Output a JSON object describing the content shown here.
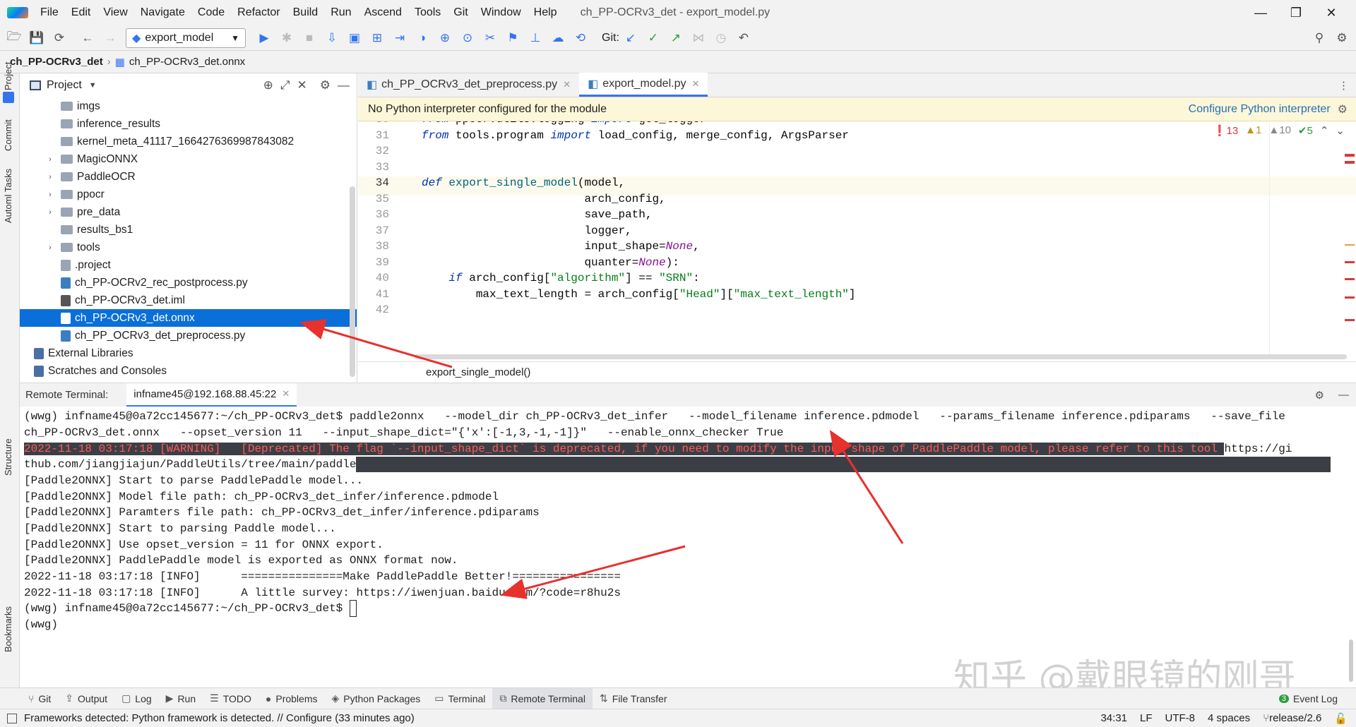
{
  "app": {
    "project": "ch_PP-OCRv3_det",
    "window_title": "ch_PP-OCRv3_det - export_model.py"
  },
  "menu": [
    "File",
    "Edit",
    "View",
    "Navigate",
    "Code",
    "Refactor",
    "Build",
    "Run",
    "Ascend",
    "Tools",
    "Git",
    "Window",
    "Help"
  ],
  "toolbar": {
    "run_config": "export_model",
    "git_label": "Git:"
  },
  "breadcrumb": {
    "project": "ch_PP-OCRv3_det",
    "file": "ch_PP-OCRv3_det.onnx"
  },
  "left_strip": {
    "project": "Project",
    "commit": "Commit",
    "automl": "Automl Tasks",
    "structure": "Structure",
    "bookmarks": "Bookmarks"
  },
  "project_panel": {
    "title": "Project",
    "items": [
      {
        "label": "imgs",
        "type": "folder",
        "arrow": ""
      },
      {
        "label": "inference_results",
        "type": "folder",
        "arrow": ""
      },
      {
        "label": "kernel_meta_41117_1664276369987843082",
        "type": "folder",
        "arrow": ""
      },
      {
        "label": "MagicONNX",
        "type": "folder",
        "arrow": "›"
      },
      {
        "label": "PaddleOCR",
        "type": "folder",
        "arrow": "›"
      },
      {
        "label": "ppocr",
        "type": "folder",
        "arrow": "›"
      },
      {
        "label": "pre_data",
        "type": "folder",
        "arrow": "›"
      },
      {
        "label": "results_bs1",
        "type": "folder",
        "arrow": ""
      },
      {
        "label": "tools",
        "type": "folder",
        "arrow": "›"
      },
      {
        "label": ".project",
        "type": "file",
        "arrow": ""
      },
      {
        "label": "ch_PP-OCRv2_rec_postprocess.py",
        "type": "py",
        "arrow": ""
      },
      {
        "label": "ch_PP-OCRv3_det.iml",
        "type": "iml",
        "arrow": ""
      },
      {
        "label": "ch_PP-OCRv3_det.onnx",
        "type": "onnx",
        "arrow": "",
        "selected": true
      },
      {
        "label": "ch_PP_OCRv3_det_preprocess.py",
        "type": "py",
        "arrow": ""
      },
      {
        "label": "External Libraries",
        "type": "lib",
        "arrow": ""
      },
      {
        "label": "Scratches and Consoles",
        "type": "scratch",
        "arrow": ""
      }
    ]
  },
  "editor": {
    "tabs": [
      {
        "label": "ch_PP_OCRv3_det_preprocess.py",
        "active": false
      },
      {
        "label": "export_model.py",
        "active": true
      }
    ],
    "banner": "No Python interpreter configured for the module",
    "banner_action": "Configure Python interpreter",
    "inspections": {
      "errors": "13",
      "warnings": "1",
      "weak": "10",
      "ok": "5"
    },
    "lines": [
      {
        "n": "30",
        "html": "<span class=\"kw\">from</span> ppocr.utils.logging <span class=\"kw\">import</span> get_logger"
      },
      {
        "n": "31",
        "html": "<span class=\"kw\">from</span> tools.program <span class=\"kw\">import</span> load_config, merge_config, ArgsParser"
      },
      {
        "n": "32",
        "html": ""
      },
      {
        "n": "33",
        "html": ""
      },
      {
        "n": "34",
        "html": "<span class=\"kw\">def</span> <span class=\"fn\">export_single_model</span>(model,"
      },
      {
        "n": "35",
        "html": "                        arch_config,"
      },
      {
        "n": "36",
        "html": "                        save_path,"
      },
      {
        "n": "37",
        "html": "                        logger,"
      },
      {
        "n": "38",
        "html": "                        input_shape=<span class=\"nn\">None</span>,"
      },
      {
        "n": "39",
        "html": "                        quanter=<span class=\"nn\">None</span>):"
      },
      {
        "n": "40",
        "html": "    <span class=\"kw\">if</span> arch_config[<span class=\"st\">\"algorithm\"</span>] == <span class=\"st\">\"SRN\"</span>:"
      },
      {
        "n": "41",
        "html": "        max_text_length = arch_config[<span class=\"st\">\"Head\"</span>][<span class=\"st\">\"max_text_length\"</span>]"
      },
      {
        "n": "42",
        "html": ""
      }
    ],
    "breadcrumb": "export_single_model()"
  },
  "terminal": {
    "label": "Remote Terminal:",
    "tab": "infname45@192.168.88.45:22",
    "lines": [
      "(wwg) infname45@0a72cc145677:~/ch_PP-OCRv3_det$ paddle2onnx   --model_dir ch_PP-OCRv3_det_infer   --model_filename inference.pdmodel   --params_filename inference.pdiparams   --save_file",
      "ch_PP-OCRv3_det.onnx   --opset_version 11   --input_shape_dict=\"{'x':[-1,3,-1,-1]}\"   --enable_onnx_checker True",
      "2022-11-18 03:17:18 [WARNING]   [Deprecated] The flag `--input_shape_dict` is deprecated, if you need to modify the input shape of PaddlePaddle model, please refer to this tool ",
      "https://gi",
      "thub.com/jiangjiajun/PaddleUtils/tree/main/paddle",
      "[Paddle2ONNX] Start to parse PaddlePaddle model...",
      "[Paddle2ONNX] Model file path: ch_PP-OCRv3_det_infer/inference.pdmodel",
      "[Paddle2ONNX] Paramters file path: ch_PP-OCRv3_det_infer/inference.pdiparams",
      "[Paddle2ONNX] Start to parsing Paddle model...",
      "[Paddle2ONNX] Use opset_version = 11 for ONNX export.",
      "[Paddle2ONNX] PaddlePaddle model is exported as ONNX format now.",
      "2022-11-18 03:17:18 [INFO]      ===============Make PaddlePaddle Better!================",
      "2022-11-18 03:17:18 [INFO]      A little survey: https://iwenjuan.baidu.com/?code=r8hu2s",
      "(wwg) infname45@0a72cc145677:~/ch_PP-OCRv3_det$ ",
      "(wwg)"
    ]
  },
  "watermark": "知乎 @戴眼镜的刚哥",
  "tool_windows": [
    {
      "label": "Git",
      "icon": "git-icon",
      "glyph": "⑂"
    },
    {
      "label": "Output",
      "icon": "output-icon",
      "glyph": "⇪"
    },
    {
      "label": "Log",
      "icon": "log-icon",
      "glyph": "▢"
    },
    {
      "label": "Run",
      "icon": "run-icon",
      "glyph": "▶"
    },
    {
      "label": "TODO",
      "icon": "todo-icon",
      "glyph": "☰"
    },
    {
      "label": "Problems",
      "icon": "problems-icon",
      "glyph": "●"
    },
    {
      "label": "Python Packages",
      "icon": "packages-icon",
      "glyph": "◈"
    },
    {
      "label": "Terminal",
      "icon": "terminal-icon",
      "glyph": "▭"
    },
    {
      "label": "Remote Terminal",
      "icon": "remote-terminal-icon",
      "glyph": "⧉",
      "active": true
    },
    {
      "label": "File Transfer",
      "icon": "file-transfer-icon",
      "glyph": "⇅"
    }
  ],
  "event_log": {
    "count": "3",
    "label": "Event Log"
  },
  "status": {
    "message": "Frameworks detected: Python framework is detected. // Configure (33 minutes ago)",
    "position": "34:31",
    "line_sep": "LF",
    "encoding": "UTF-8",
    "indent": "4 spaces",
    "branch": "release/2.6"
  }
}
